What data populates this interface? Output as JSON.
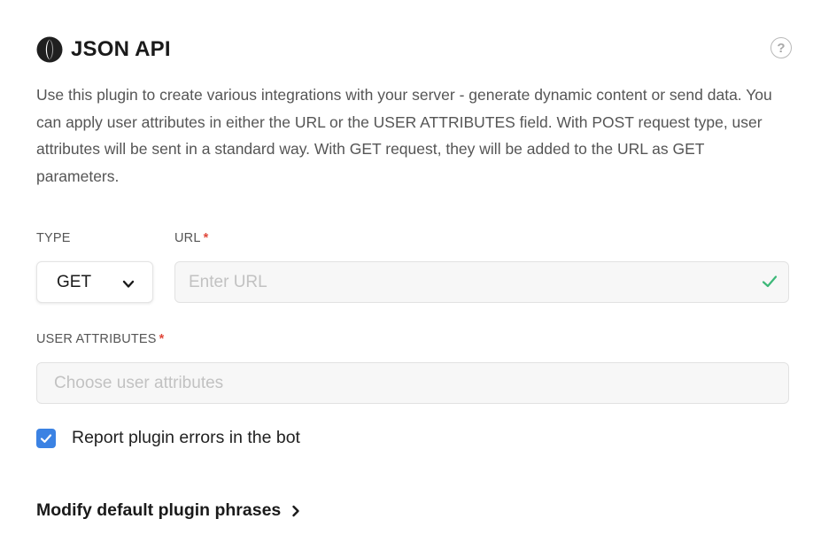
{
  "header": {
    "title": "JSON API",
    "logo_icon": "json-logo-icon",
    "help_icon": "help-circle-icon",
    "help_glyph": "?"
  },
  "description": "Use this plugin to create various integrations with your server - generate dynamic content or send data. You can apply user attributes in either the URL or the USER ATTRIBUTES field. With POST request type, user attributes will be sent in a standard way. With GET request, they will be added to the URL as GET parameters.",
  "form": {
    "type": {
      "label": "TYPE",
      "value": "GET",
      "icon": "chevron-down-icon"
    },
    "url": {
      "label": "URL",
      "required_mark": "*",
      "value": "",
      "placeholder": "Enter URL",
      "status_icon": "check-icon"
    },
    "user_attributes": {
      "label": "USER ATTRIBUTES",
      "required_mark": "*",
      "value": "",
      "placeholder": "Choose user attributes"
    },
    "report_errors": {
      "label": "Report plugin errors in the bot",
      "checked": true
    }
  },
  "modify_link": {
    "label": "Modify default plugin phrases",
    "icon": "chevron-right-icon"
  },
  "colors": {
    "accent": "#3b82e3",
    "required": "#e0483b",
    "valid": "#3cb878",
    "text": "#222222",
    "muted": "#555555"
  }
}
